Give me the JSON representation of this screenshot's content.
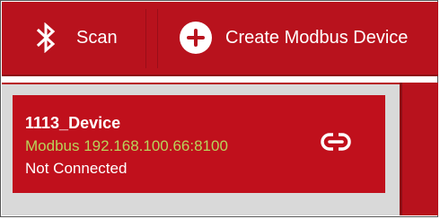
{
  "toolbar": {
    "scan_label": "Scan",
    "create_label": "Create Modbus Device",
    "scan_icon": "bluetooth-icon",
    "create_icon": "plus-circle-icon"
  },
  "device": {
    "name": "1113_Device",
    "address": "Modbus 192.168.100.66:8100",
    "status": "Not Connected",
    "link_icon": "link-icon"
  },
  "colors": {
    "accent": "#b8121d",
    "address_text": "#b9d35a"
  }
}
